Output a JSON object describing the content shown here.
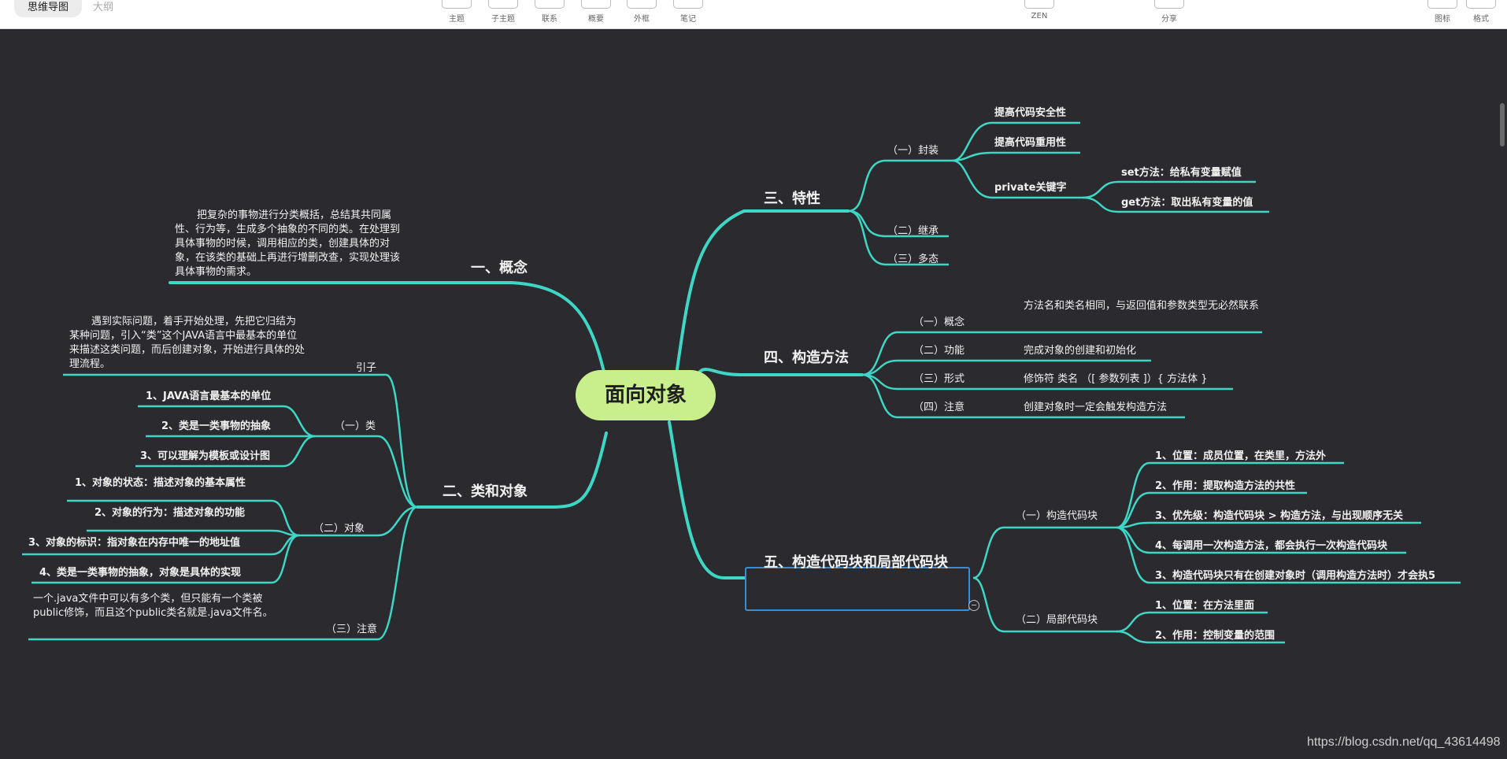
{
  "toolbar": {
    "tab_mindmap": "思维导图",
    "tab_outline": "大纲",
    "items": [
      "主题",
      "子主题",
      "联系",
      "概要",
      "外框",
      "笔记"
    ],
    "zen": "ZEN",
    "share": "分享",
    "icon": "图标",
    "format": "格式"
  },
  "root": "面向对象",
  "b1": {
    "title": "一、概念",
    "desc": "把复杂的事物进行分类概括，总结其共同属性、行为等，生成多个抽象的不同的类。在处理到具体事物的时候，调用相应的类，创建具体的对象，在该类的基础上再进行增删改查，实现处理该具体事物的需求。"
  },
  "b2": {
    "title": "二、类和对象",
    "intro_label": "引子",
    "intro_text": "遇到实际问题，着手开始处理，先把它归结为某种问题，引入“类”这个JAVA语言中最基本的单位来描述这类问题，而后创建对象，开始进行具体的处理流程。",
    "class_label": "（一）类",
    "class_items": [
      "1、JAVA语言最基本的单位",
      "2、类是一类事物的抽象",
      "3、可以理解为模板或设计图"
    ],
    "object_label": "（二）对象",
    "object_items": [
      "1、对象的状态：描述对象的基本属性",
      "2、对象的行为：描述对象的功能",
      "3、对象的标识：指对象在内存中唯一的地址值",
      "4、类是一类事物的抽象，对象是具体的实现"
    ],
    "note_label": "（三）注意",
    "note_text": "一个.java文件中可以有多个类，但只能有一个类被public修饰，而且这个public类名就是.java文件名。"
  },
  "b3": {
    "title": "三、特性",
    "enc": "（一）封装",
    "enc_items": [
      "提高代码安全性",
      "提高代码重用性",
      "private关键字"
    ],
    "private_items": [
      "set方法：给私有变量赋值",
      "get方法：取出私有变量的值"
    ],
    "inherit": "（二）继承",
    "poly": "（三）多态"
  },
  "b4": {
    "title": "四、构造方法",
    "labels": [
      "（一）概念",
      "（二）功能",
      "（三）形式",
      "（四）注意"
    ],
    "texts": [
      "方法名和类名相同，与返回值和参数类型无必然联系",
      "完成对象的创建和初始化",
      "修饰符 类名 （[ 参数列表 ]）{ 方法体 }",
      "创建对象时一定会触发构造方法"
    ]
  },
  "b5": {
    "title": "五、构造代码块和局部代码块",
    "block": "（一）构造代码块",
    "block_items": [
      "1、位置：成员位置，在类里，方法外",
      "2、作用：提取构造方法的共性",
      "3、优先级：构造代码块 > 构造方法，与出现顺序无关",
      "4、每调用一次构造方法，都会执行一次构造代码块",
      "3、构造代码块只有在创建对象时（调用构造方法时）才会执5"
    ],
    "local": "（二）局部代码块",
    "local_items": [
      "1、位置：在方法里面",
      "2、作用：控制变量的范围"
    ]
  },
  "watermark": "https://blog.csdn.net/qq_43614498",
  "colors": {
    "line": "#3ed6c4",
    "root": "#c8ef8c",
    "select": "#3b8ed6",
    "bg": "#2b2a2f"
  }
}
